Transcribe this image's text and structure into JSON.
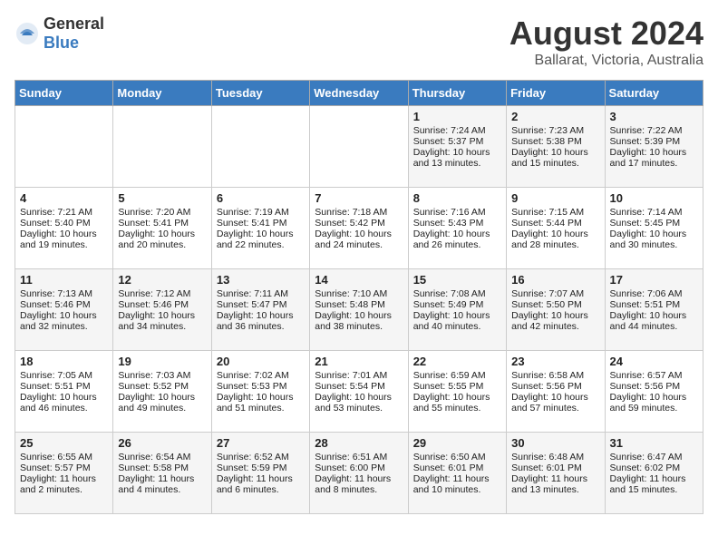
{
  "header": {
    "logo_general": "General",
    "logo_blue": "Blue",
    "title": "August 2024",
    "subtitle": "Ballarat, Victoria, Australia"
  },
  "days_of_week": [
    "Sunday",
    "Monday",
    "Tuesday",
    "Wednesday",
    "Thursday",
    "Friday",
    "Saturday"
  ],
  "weeks": [
    {
      "days": [
        {
          "number": "",
          "sunrise": "",
          "sunset": "",
          "daylight": "",
          "empty": true
        },
        {
          "number": "",
          "sunrise": "",
          "sunset": "",
          "daylight": "",
          "empty": true
        },
        {
          "number": "",
          "sunrise": "",
          "sunset": "",
          "daylight": "",
          "empty": true
        },
        {
          "number": "",
          "sunrise": "",
          "sunset": "",
          "daylight": "",
          "empty": true
        },
        {
          "number": "1",
          "sunrise": "Sunrise: 7:24 AM",
          "sunset": "Sunset: 5:37 PM",
          "daylight": "Daylight: 10 hours and 13 minutes."
        },
        {
          "number": "2",
          "sunrise": "Sunrise: 7:23 AM",
          "sunset": "Sunset: 5:38 PM",
          "daylight": "Daylight: 10 hours and 15 minutes."
        },
        {
          "number": "3",
          "sunrise": "Sunrise: 7:22 AM",
          "sunset": "Sunset: 5:39 PM",
          "daylight": "Daylight: 10 hours and 17 minutes."
        }
      ]
    },
    {
      "days": [
        {
          "number": "4",
          "sunrise": "Sunrise: 7:21 AM",
          "sunset": "Sunset: 5:40 PM",
          "daylight": "Daylight: 10 hours and 19 minutes."
        },
        {
          "number": "5",
          "sunrise": "Sunrise: 7:20 AM",
          "sunset": "Sunset: 5:41 PM",
          "daylight": "Daylight: 10 hours and 20 minutes."
        },
        {
          "number": "6",
          "sunrise": "Sunrise: 7:19 AM",
          "sunset": "Sunset: 5:41 PM",
          "daylight": "Daylight: 10 hours and 22 minutes."
        },
        {
          "number": "7",
          "sunrise": "Sunrise: 7:18 AM",
          "sunset": "Sunset: 5:42 PM",
          "daylight": "Daylight: 10 hours and 24 minutes."
        },
        {
          "number": "8",
          "sunrise": "Sunrise: 7:16 AM",
          "sunset": "Sunset: 5:43 PM",
          "daylight": "Daylight: 10 hours and 26 minutes."
        },
        {
          "number": "9",
          "sunrise": "Sunrise: 7:15 AM",
          "sunset": "Sunset: 5:44 PM",
          "daylight": "Daylight: 10 hours and 28 minutes."
        },
        {
          "number": "10",
          "sunrise": "Sunrise: 7:14 AM",
          "sunset": "Sunset: 5:45 PM",
          "daylight": "Daylight: 10 hours and 30 minutes."
        }
      ]
    },
    {
      "days": [
        {
          "number": "11",
          "sunrise": "Sunrise: 7:13 AM",
          "sunset": "Sunset: 5:46 PM",
          "daylight": "Daylight: 10 hours and 32 minutes."
        },
        {
          "number": "12",
          "sunrise": "Sunrise: 7:12 AM",
          "sunset": "Sunset: 5:46 PM",
          "daylight": "Daylight: 10 hours and 34 minutes."
        },
        {
          "number": "13",
          "sunrise": "Sunrise: 7:11 AM",
          "sunset": "Sunset: 5:47 PM",
          "daylight": "Daylight: 10 hours and 36 minutes."
        },
        {
          "number": "14",
          "sunrise": "Sunrise: 7:10 AM",
          "sunset": "Sunset: 5:48 PM",
          "daylight": "Daylight: 10 hours and 38 minutes."
        },
        {
          "number": "15",
          "sunrise": "Sunrise: 7:08 AM",
          "sunset": "Sunset: 5:49 PM",
          "daylight": "Daylight: 10 hours and 40 minutes."
        },
        {
          "number": "16",
          "sunrise": "Sunrise: 7:07 AM",
          "sunset": "Sunset: 5:50 PM",
          "daylight": "Daylight: 10 hours and 42 minutes."
        },
        {
          "number": "17",
          "sunrise": "Sunrise: 7:06 AM",
          "sunset": "Sunset: 5:51 PM",
          "daylight": "Daylight: 10 hours and 44 minutes."
        }
      ]
    },
    {
      "days": [
        {
          "number": "18",
          "sunrise": "Sunrise: 7:05 AM",
          "sunset": "Sunset: 5:51 PM",
          "daylight": "Daylight: 10 hours and 46 minutes."
        },
        {
          "number": "19",
          "sunrise": "Sunrise: 7:03 AM",
          "sunset": "Sunset: 5:52 PM",
          "daylight": "Daylight: 10 hours and 49 minutes."
        },
        {
          "number": "20",
          "sunrise": "Sunrise: 7:02 AM",
          "sunset": "Sunset: 5:53 PM",
          "daylight": "Daylight: 10 hours and 51 minutes."
        },
        {
          "number": "21",
          "sunrise": "Sunrise: 7:01 AM",
          "sunset": "Sunset: 5:54 PM",
          "daylight": "Daylight: 10 hours and 53 minutes."
        },
        {
          "number": "22",
          "sunrise": "Sunrise: 6:59 AM",
          "sunset": "Sunset: 5:55 PM",
          "daylight": "Daylight: 10 hours and 55 minutes."
        },
        {
          "number": "23",
          "sunrise": "Sunrise: 6:58 AM",
          "sunset": "Sunset: 5:56 PM",
          "daylight": "Daylight: 10 hours and 57 minutes."
        },
        {
          "number": "24",
          "sunrise": "Sunrise: 6:57 AM",
          "sunset": "Sunset: 5:56 PM",
          "daylight": "Daylight: 10 hours and 59 minutes."
        }
      ]
    },
    {
      "days": [
        {
          "number": "25",
          "sunrise": "Sunrise: 6:55 AM",
          "sunset": "Sunset: 5:57 PM",
          "daylight": "Daylight: 11 hours and 2 minutes."
        },
        {
          "number": "26",
          "sunrise": "Sunrise: 6:54 AM",
          "sunset": "Sunset: 5:58 PM",
          "daylight": "Daylight: 11 hours and 4 minutes."
        },
        {
          "number": "27",
          "sunrise": "Sunrise: 6:52 AM",
          "sunset": "Sunset: 5:59 PM",
          "daylight": "Daylight: 11 hours and 6 minutes."
        },
        {
          "number": "28",
          "sunrise": "Sunrise: 6:51 AM",
          "sunset": "Sunset: 6:00 PM",
          "daylight": "Daylight: 11 hours and 8 minutes."
        },
        {
          "number": "29",
          "sunrise": "Sunrise: 6:50 AM",
          "sunset": "Sunset: 6:01 PM",
          "daylight": "Daylight: 11 hours and 10 minutes."
        },
        {
          "number": "30",
          "sunrise": "Sunrise: 6:48 AM",
          "sunset": "Sunset: 6:01 PM",
          "daylight": "Daylight: 11 hours and 13 minutes."
        },
        {
          "number": "31",
          "sunrise": "Sunrise: 6:47 AM",
          "sunset": "Sunset: 6:02 PM",
          "daylight": "Daylight: 11 hours and 15 minutes."
        }
      ]
    }
  ]
}
